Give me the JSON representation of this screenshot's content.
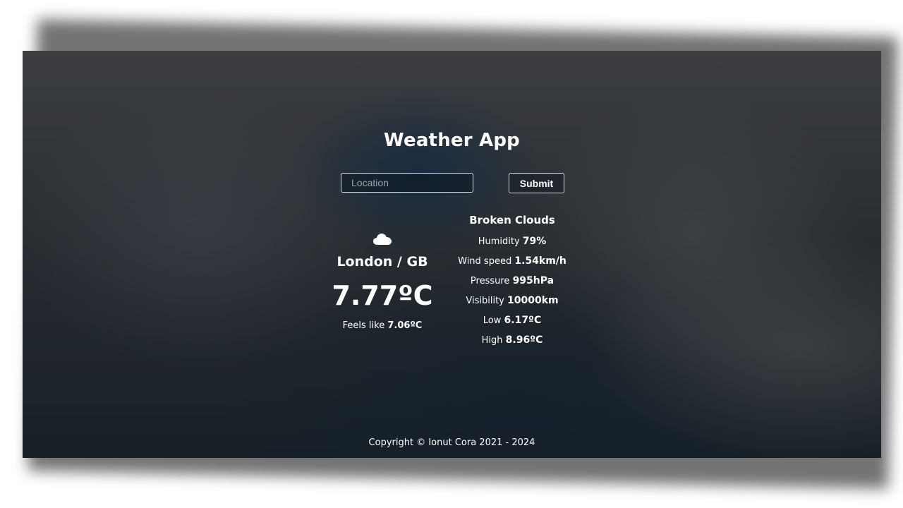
{
  "app": {
    "title": "Weather App"
  },
  "search": {
    "placeholder": "Location",
    "value": "",
    "submit_label": "Submit"
  },
  "current": {
    "icon": "cloud-icon",
    "location": "London / GB",
    "temperature": "7.77ºC",
    "feels_like_label": "Feels like",
    "feels_like_value": "7.06ºC"
  },
  "details": {
    "description": "Broken Clouds",
    "humidity_label": "Humidity",
    "humidity_value": "79%",
    "wind_label": "Wind speed",
    "wind_value": "1.54km/h",
    "pressure_label": "Pressure",
    "pressure_value": "995hPa",
    "visibility_label": "Visibility",
    "visibility_value": "10000km",
    "low_label": "Low",
    "low_value": "6.17ºC",
    "high_label": "High",
    "high_value": "8.96ºC"
  },
  "footer": {
    "copyright": "Copyright © Ionut Cora 2021 - 2024"
  },
  "colors": {
    "text": "#ffffff",
    "input_border": "#d9dfe4",
    "sky_dark": "#1d2830",
    "cloud_gray": "#4a4c4f"
  }
}
